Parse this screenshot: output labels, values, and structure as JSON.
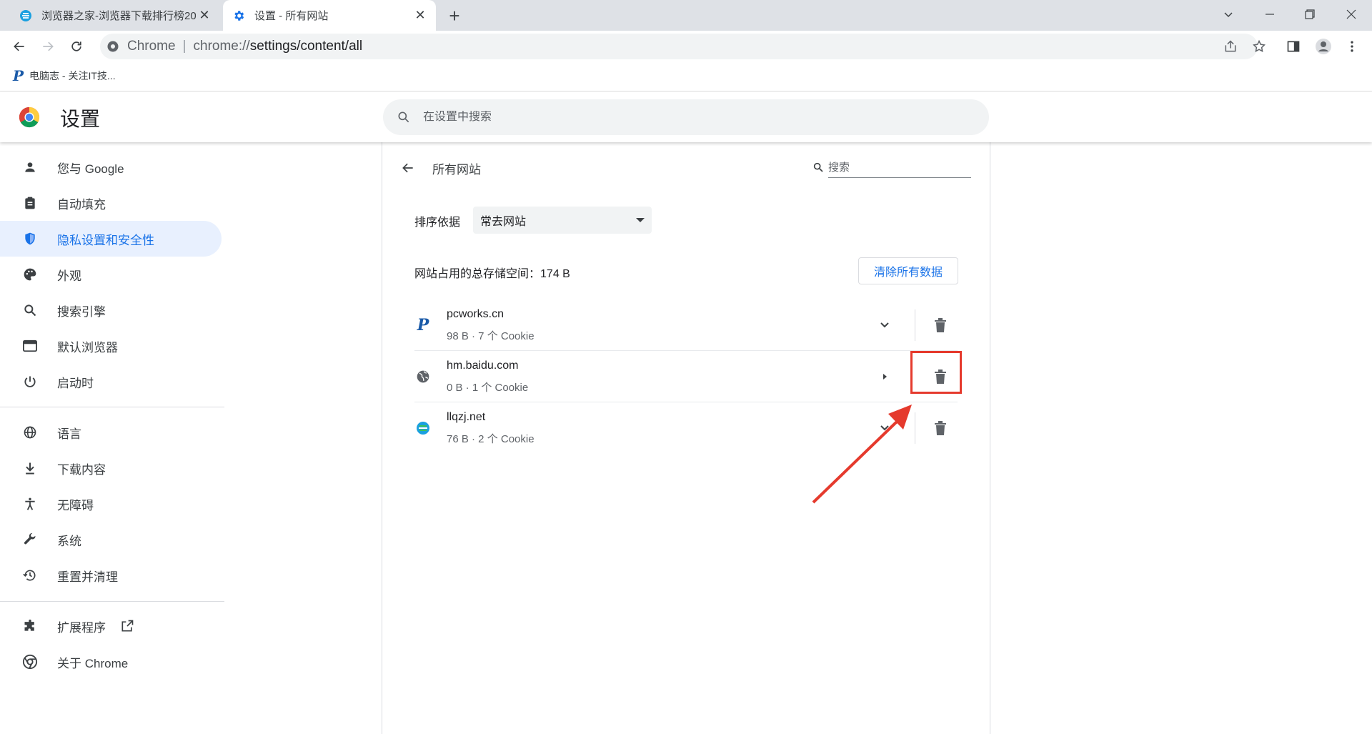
{
  "tabs": [
    {
      "title": "浏览器之家-浏览器下载排行榜20",
      "active": false
    },
    {
      "title": "设置 - 所有网站",
      "active": true
    }
  ],
  "omnibox": {
    "scheme": "Chrome",
    "separator": "|",
    "url_host": "chrome://",
    "url_path": "settings/content/all"
  },
  "bookmarks": [
    {
      "icon": "P",
      "label": "电脑志 - 关注IT技..."
    }
  ],
  "settings": {
    "title": "设置",
    "search_placeholder": "在设置中搜索"
  },
  "sidebar": {
    "items": [
      {
        "label": "您与 Google",
        "icon": "person-icon",
        "active": false
      },
      {
        "label": "自动填充",
        "icon": "clipboard-icon",
        "active": false
      },
      {
        "label": "隐私设置和安全性",
        "icon": "shield-icon",
        "active": true
      },
      {
        "label": "外观",
        "icon": "palette-icon",
        "active": false
      },
      {
        "label": "搜索引擎",
        "icon": "search-icon",
        "active": false
      },
      {
        "label": "默认浏览器",
        "icon": "browser-window-icon",
        "active": false
      },
      {
        "label": "启动时",
        "icon": "power-icon",
        "active": false
      },
      {
        "label": "语言",
        "icon": "globe-icon",
        "active": false
      },
      {
        "label": "下载内容",
        "icon": "download-icon",
        "active": false
      },
      {
        "label": "无障碍",
        "icon": "accessibility-icon",
        "active": false
      },
      {
        "label": "系统",
        "icon": "wrench-icon",
        "active": false
      },
      {
        "label": "重置并清理",
        "icon": "history-icon",
        "active": false
      },
      {
        "label": "扩展程序",
        "icon": "puzzle-icon",
        "active": false
      },
      {
        "label": "关于 Chrome",
        "icon": "chrome-icon",
        "active": false
      }
    ]
  },
  "subpage": {
    "title": "所有网站",
    "search_placeholder": "搜索",
    "sort_label": "排序依据",
    "sort_value": "常去网站",
    "storage_label": "网站占用的总存储空间：",
    "storage_value": "174 B",
    "clear_button": "清除所有数据",
    "sites": [
      {
        "name": "pcworks.cn",
        "meta": "98 B · 7 个 Cookie",
        "favicon": "P",
        "expand": "chevron-down-icon"
      },
      {
        "name": "hm.baidu.com",
        "meta": "0 B · 1 个 Cookie",
        "favicon": "globe-icon",
        "expand": "caret-right-icon"
      },
      {
        "name": "llqzj.net",
        "meta": "76 B · 2 个 Cookie",
        "favicon": "e-icon",
        "expand": "chevron-down-icon"
      }
    ]
  },
  "colors": {
    "accent": "#1a73e8",
    "annotation": "#e53a2d",
    "active_bg": "#e8f0fe"
  }
}
